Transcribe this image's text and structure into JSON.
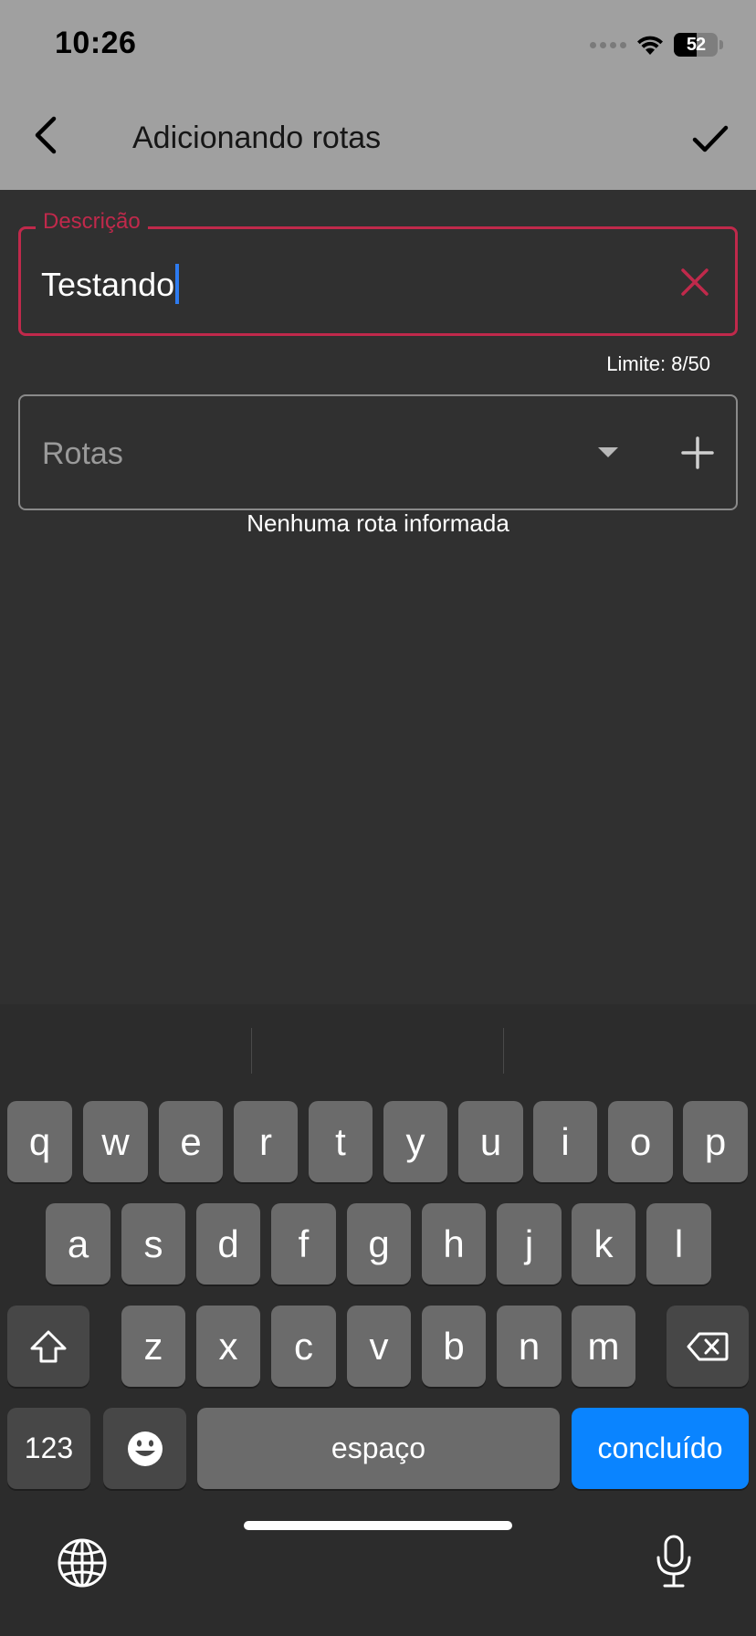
{
  "status_bar": {
    "time": "10:26",
    "battery": "52",
    "signal_icon": "cellular-signal-icon",
    "wifi_icon": "wifi-icon",
    "battery_icon": "battery-icon"
  },
  "app_bar": {
    "title": "Adicionando rotas",
    "back_icon": "back-chevron-icon",
    "confirm_icon": "check-icon",
    "background": "#a0a0a0"
  },
  "form": {
    "description": {
      "label": "Descrição",
      "value": "Testando",
      "clear_icon": "close-icon",
      "limit_text": "Limite: 8/50",
      "accent_color": "#c0294b"
    },
    "routes": {
      "placeholder": "Rotas",
      "dropdown_icon": "dropdown-arrow-icon",
      "add_icon": "plus-icon",
      "empty_message": "Nenhuma rota informada"
    }
  },
  "keyboard": {
    "row1": [
      "q",
      "w",
      "e",
      "r",
      "t",
      "y",
      "u",
      "i",
      "o",
      "p"
    ],
    "row2": [
      "a",
      "s",
      "d",
      "f",
      "g",
      "h",
      "j",
      "k",
      "l"
    ],
    "row3": [
      "z",
      "x",
      "c",
      "v",
      "b",
      "n",
      "m"
    ],
    "numbers_label": "123",
    "space_label": "espaço",
    "done_label": "concluído",
    "shift_icon": "shift-icon",
    "backspace_icon": "backspace-icon",
    "emoji_icon": "emoji-icon",
    "globe_icon": "globe-icon",
    "mic_icon": "microphone-icon",
    "done_color": "#0a84ff"
  }
}
